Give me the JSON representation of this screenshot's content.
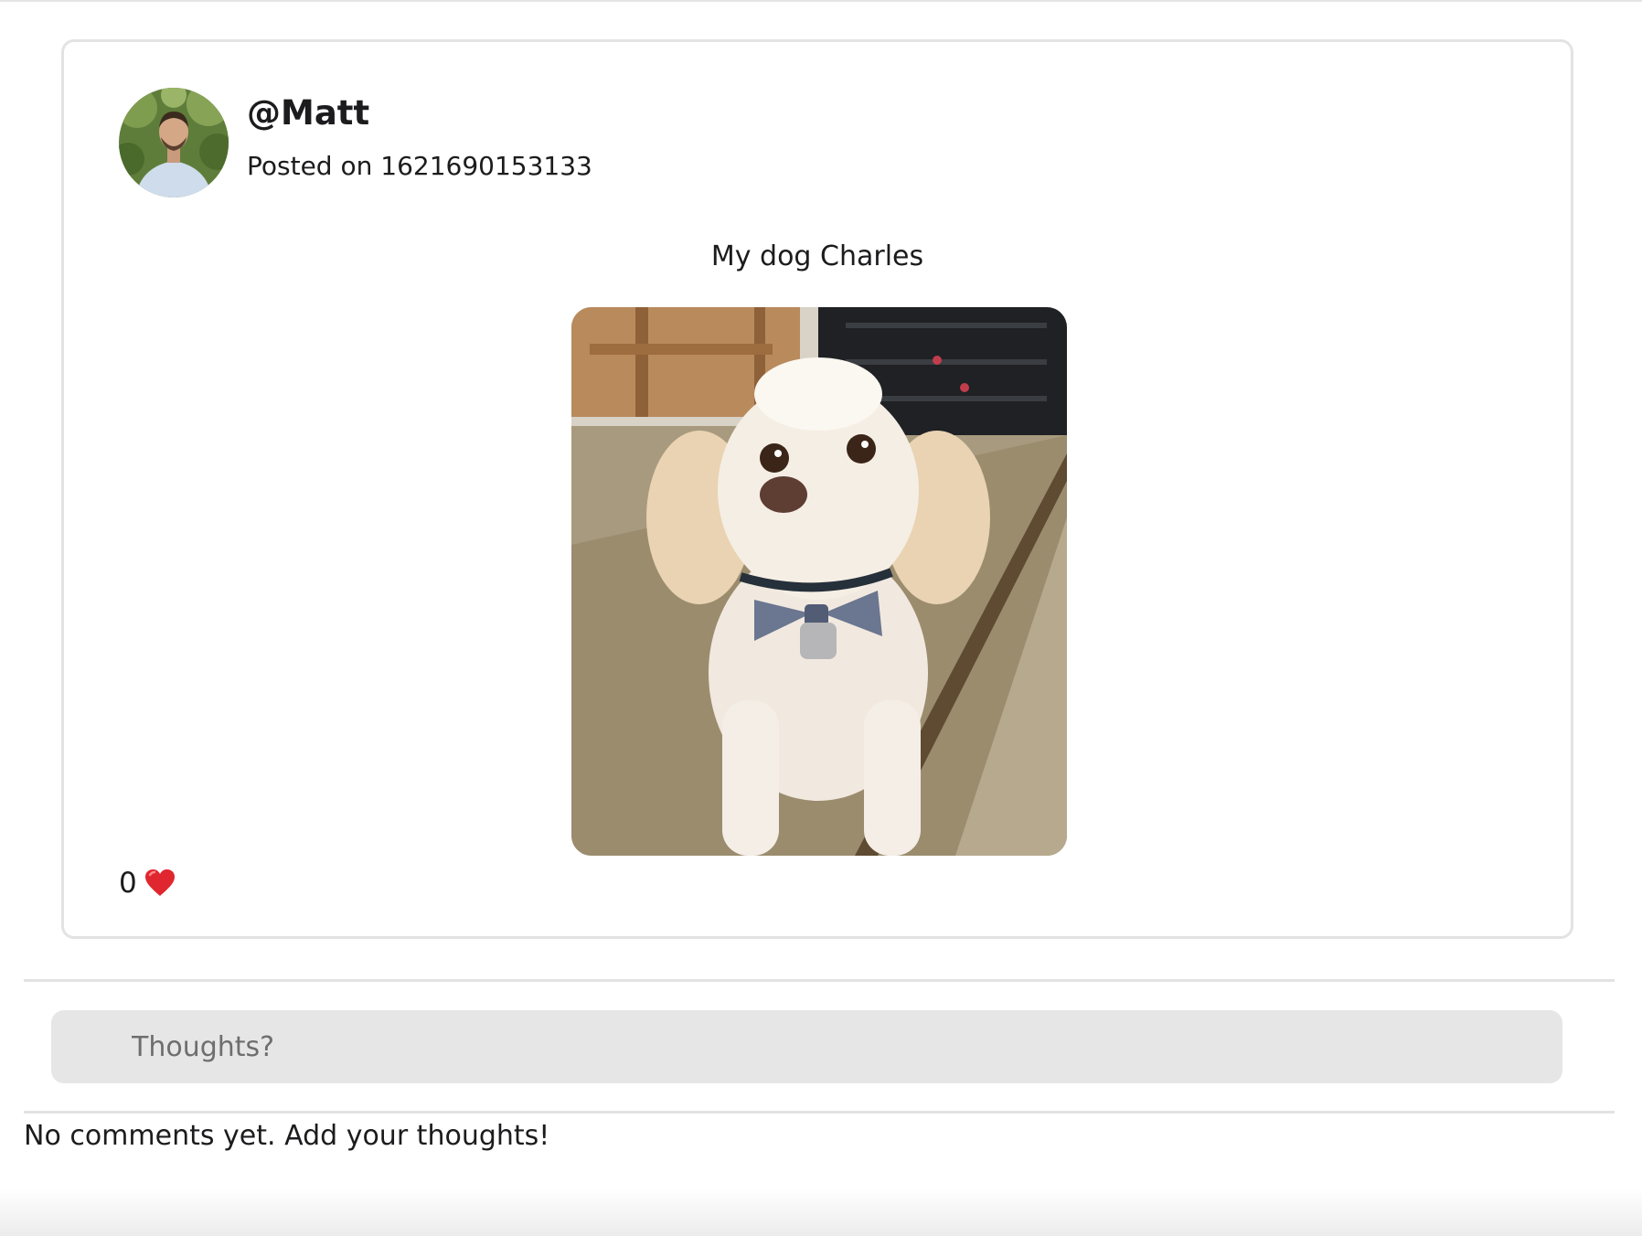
{
  "post": {
    "username": "@Matt",
    "posted_label": "Posted on",
    "posted_value": "1621690153133",
    "caption": "My dog Charles",
    "likes_count": "0",
    "avatar_icon": "user-avatar-photo",
    "image_icon": "dog-photo",
    "heart_icon": "heart-icon",
    "heart_color": "#e0262f"
  },
  "comments": {
    "input_placeholder": "Thoughts?",
    "empty_message": "No comments yet. Add your thoughts!"
  }
}
